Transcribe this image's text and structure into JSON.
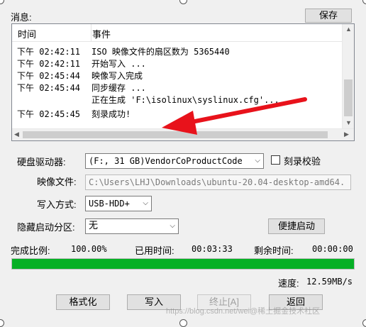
{
  "messages_label": "消息:",
  "save_label": "保存",
  "log": {
    "col_time": "时间",
    "col_event": "事件",
    "rows": [
      {
        "time": "下午 02:42:11",
        "event": "ISO 映像文件的扇区数为 5365440"
      },
      {
        "time": "下午 02:42:11",
        "event": "开始写入 ..."
      },
      {
        "time": "下午 02:45:44",
        "event": "映像写入完成"
      },
      {
        "time": "下午 02:45:44",
        "event": "同步缓存 ..."
      },
      {
        "time": "",
        "event": "正在生成 'F:\\isolinux\\syslinux.cfg'..."
      },
      {
        "time": "下午 02:45:45",
        "event": "刻录成功!"
      }
    ]
  },
  "drive_label": "硬盘驱动器:",
  "drive_value": "(F:, 31 GB)VendorCoProductCode",
  "verify_label": "刻录校验",
  "image_label": "映像文件:",
  "image_path": "C:\\Users\\LHJ\\Downloads\\ubuntu-20.04-desktop-amd64.",
  "write_mode_label": "写入方式:",
  "write_mode_value": "USB-HDD+",
  "hidden_partition_label": "隐藏启动分区:",
  "hidden_partition_value": "无",
  "quick_boot_label": "便捷启动",
  "progress": {
    "complete_label": "完成比例:",
    "complete_value": "100.00%",
    "elapsed_label": "已用时间:",
    "elapsed_value": "00:03:33",
    "remaining_label": "剩余时间:",
    "remaining_value": "00:00:00",
    "fraction": 1.0
  },
  "speed_label": "速度:",
  "speed_value": "12.59MB/s",
  "buttons": {
    "format": "格式化",
    "write": "写入",
    "abort": "终止[A]",
    "back": "返回"
  },
  "watermark": "https://blog.csdn.net/wei@稀土掘金技术社区",
  "colors": {
    "annotation_arrow": "#e8121b",
    "progress_fill": "#06b025"
  }
}
